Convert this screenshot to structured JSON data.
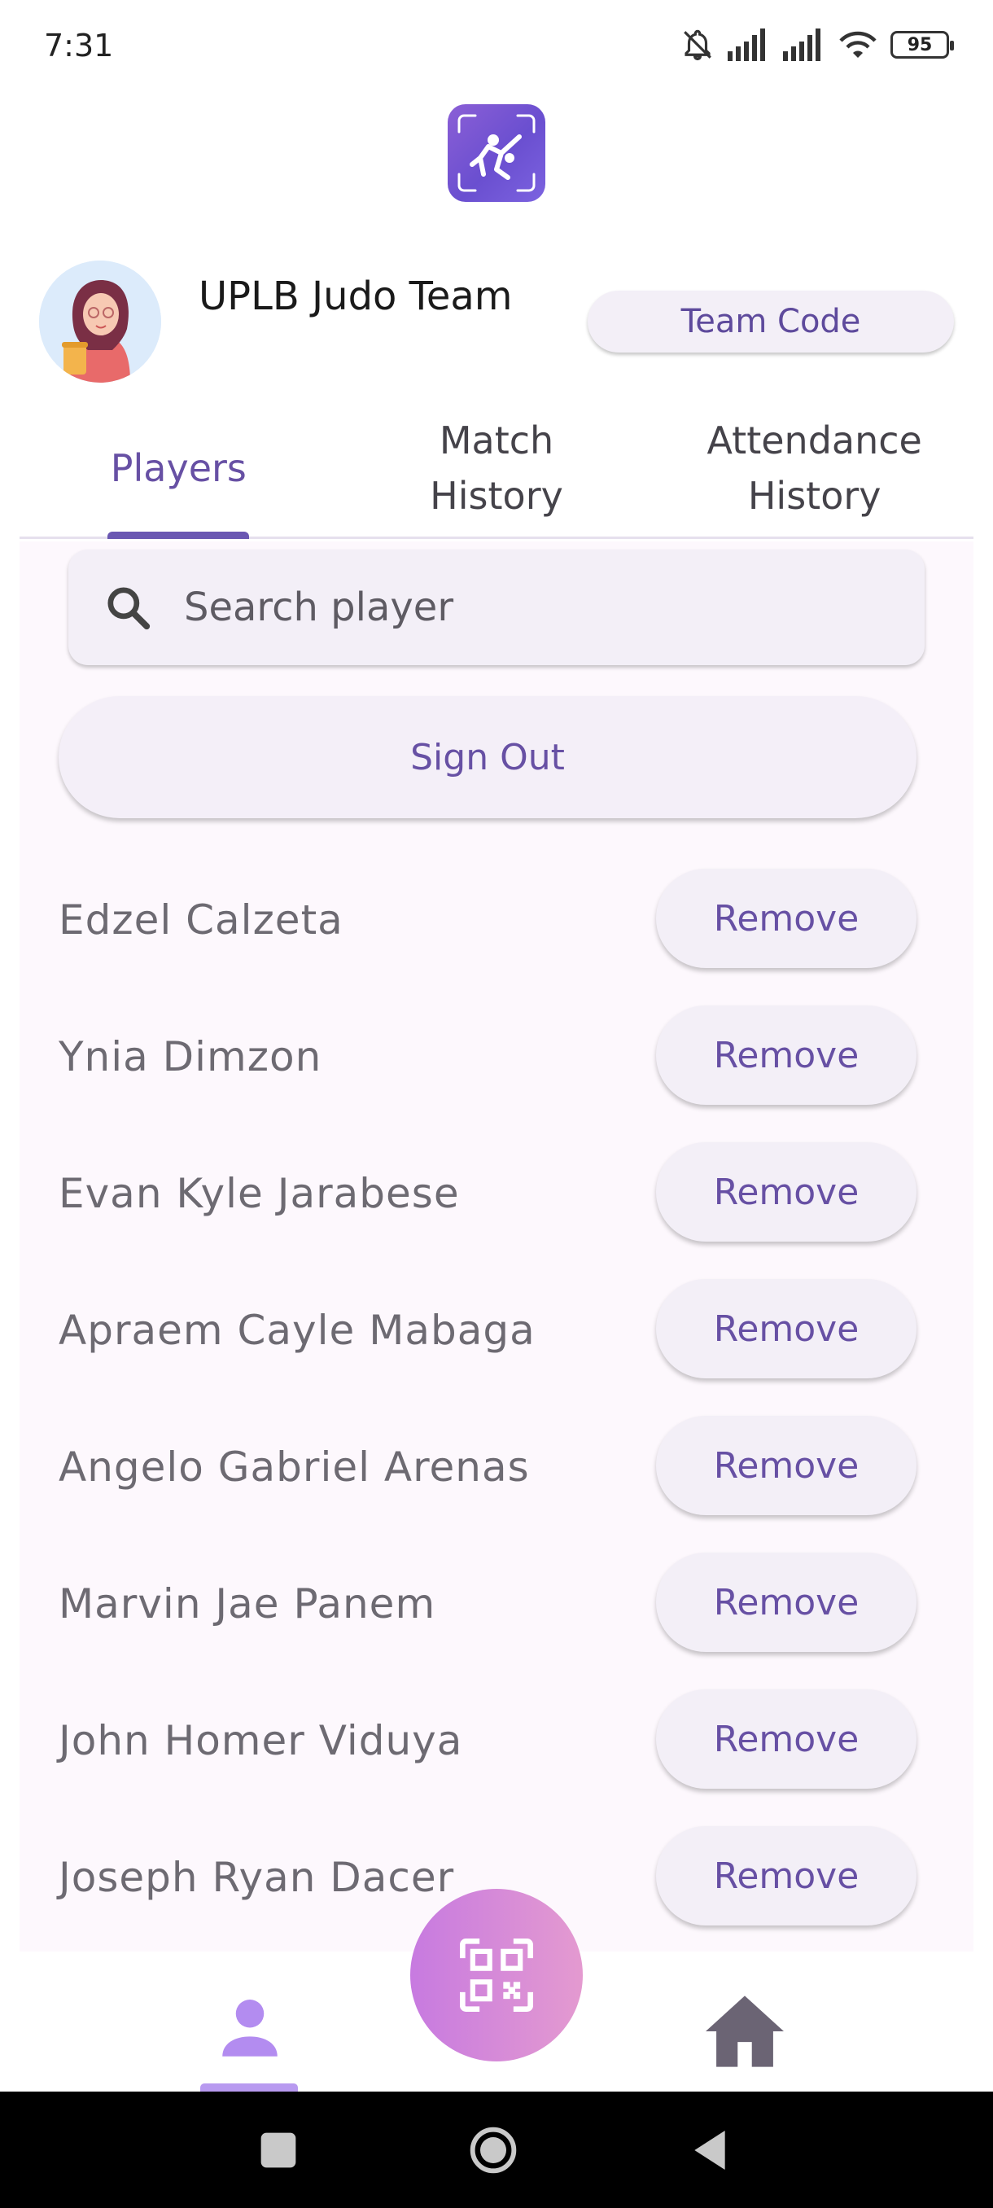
{
  "status_bar": {
    "time": "7:31",
    "battery_level": "95",
    "icons": [
      "bell-off-icon",
      "signal-icon",
      "signal-icon",
      "wifi-icon",
      "battery-icon"
    ]
  },
  "header": {
    "logo_icon": "judo-logo-icon",
    "avatar_icon": "avatar-illustration-icon",
    "team_name": "UPLB Judo Team",
    "team_code_label": "Team Code"
  },
  "tabs": [
    {
      "label": "Players",
      "active": true
    },
    {
      "label": "Match\nHistory",
      "active": false
    },
    {
      "label": "Attendance\nHistory",
      "active": false
    }
  ],
  "search": {
    "placeholder": "Search player",
    "value": ""
  },
  "sign_out_label": "Sign Out",
  "players": [
    {
      "name": "Edzel Calzeta",
      "action": "Remove"
    },
    {
      "name": "Ynia Dimzon",
      "action": "Remove"
    },
    {
      "name": "Evan Kyle Jarabese",
      "action": "Remove"
    },
    {
      "name": "Apraem Cayle Mabaga",
      "action": "Remove"
    },
    {
      "name": "Angelo Gabriel Arenas",
      "action": "Remove"
    },
    {
      "name": "Marvin Jae Panem",
      "action": "Remove"
    },
    {
      "name": "John Homer Viduya",
      "action": "Remove"
    },
    {
      "name": "Joseph Ryan Dacer",
      "action": "Remove"
    }
  ],
  "bottom_nav": {
    "items": [
      "person-icon",
      "qr-code-icon",
      "home-icon"
    ],
    "active": "person-icon"
  },
  "colors": {
    "accent": "#6750a4",
    "panel_background": "#fdf8fd",
    "button_background": "#f3eff7",
    "fab_gradient_start": "#c77ae0",
    "fab_gradient_end": "#e49ad0"
  }
}
